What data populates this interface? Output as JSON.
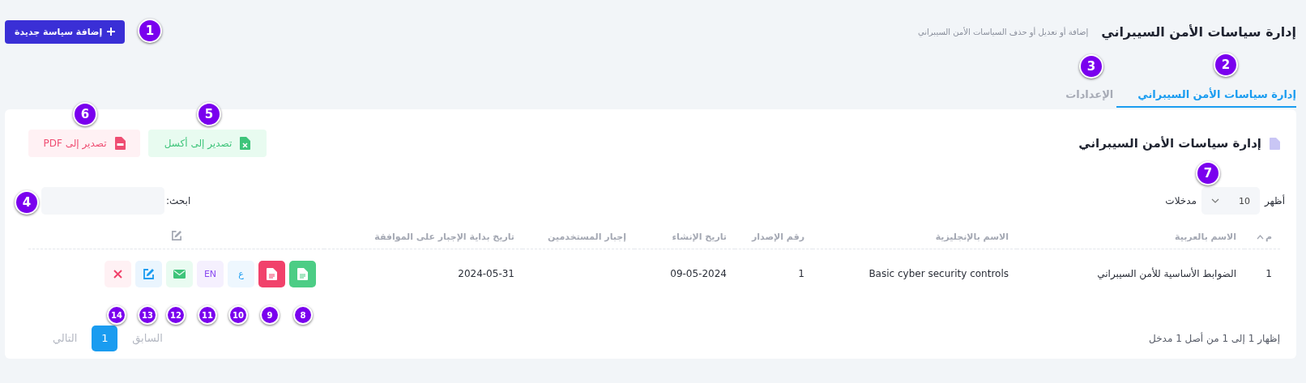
{
  "header": {
    "title": "إدارة سياسات الأمن السيبراني",
    "subtitle": "إضافة أو تعديل أو حذف السياسات الأمن السيبراني",
    "add_button": "إضافة سياسة جديدة"
  },
  "tabs": [
    {
      "label": "إدارة سياسات الأمن السيبراني",
      "selected": true
    },
    {
      "label": "الإعدادات",
      "selected": false
    }
  ],
  "card": {
    "title": "إدارة سياسات الأمن السيبراني",
    "export_buttons": [
      {
        "kind": "excel",
        "label": "تصدير إلى أكسل"
      },
      {
        "kind": "pdf",
        "label": "تصدير إلى PDF"
      }
    ],
    "length": {
      "show": "أظهر",
      "value": "10",
      "entries": "مدخلات"
    },
    "search": {
      "label": "ابحث:"
    },
    "table": {
      "columns": [
        "م",
        "الاسم بالعربية",
        "الاسم بالإنجليزية",
        "رقم الإصدار",
        "تاريخ الإنشاء",
        "إجبار المستخدمين",
        "تاريخ بداية الإجبار على الموافقة"
      ],
      "rows": [
        {
          "cells": [
            "1",
            "الضوابط الأساسية للأمن السيبراني",
            "Basic cyber security controls",
            "1",
            "09-05-2024",
            "",
            "2024-05-31"
          ],
          "actions": [
            {
              "kind": "doc-green"
            },
            {
              "kind": "doc-red"
            },
            {
              "kind": "text-blue",
              "label": "ع"
            },
            {
              "kind": "text-purple",
              "label": "EN"
            },
            {
              "kind": "mail"
            },
            {
              "kind": "edit"
            },
            {
              "kind": "delete"
            }
          ]
        }
      ]
    },
    "info": "إظهار 1 إلى 1 من أصل 1 مدخل",
    "pagination": [
      {
        "label": "السابق",
        "kind": "prev",
        "selected": false
      },
      {
        "label": "1",
        "kind": "page",
        "selected": true
      },
      {
        "label": "التالي",
        "kind": "next",
        "selected": false
      }
    ]
  },
  "callouts": [
    {
      "label": "1",
      "kind": "large"
    },
    {
      "label": "2",
      "kind": "large"
    },
    {
      "label": "3",
      "kind": "large"
    },
    {
      "label": "4",
      "kind": "large"
    },
    {
      "label": "5",
      "kind": "large"
    },
    {
      "label": "6",
      "kind": "large"
    },
    {
      "label": "7",
      "kind": "large"
    },
    {
      "label": "8",
      "kind": "small"
    },
    {
      "label": "9",
      "kind": "small"
    },
    {
      "label": "10",
      "kind": "small"
    },
    {
      "label": "11",
      "kind": "small"
    },
    {
      "label": "12",
      "kind": "small"
    },
    {
      "label": "13",
      "kind": "small"
    },
    {
      "label": "14",
      "kind": "small"
    }
  ]
}
